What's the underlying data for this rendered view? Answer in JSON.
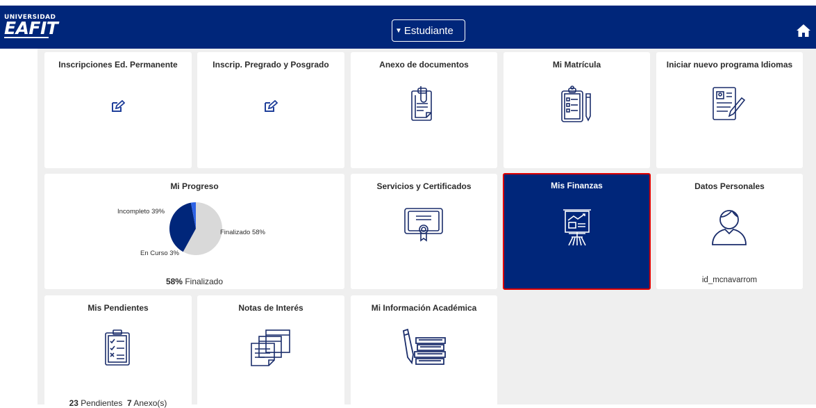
{
  "header": {
    "logo_top": "UNIVERSIDAD",
    "logo_main": "EAFIT",
    "role_selector": "Estudiante",
    "home_icon": "home-icon"
  },
  "tiles": {
    "inscripciones": {
      "title": "Inscripciones Ed. Permanente",
      "icon": "edit-icon"
    },
    "inscrip_pregrado": {
      "title": "Inscrip. Pregrado y Posgrado",
      "icon": "edit-icon"
    },
    "anexo": {
      "title": "Anexo de documentos",
      "icon": "clipboard-attachment-icon"
    },
    "matricula": {
      "title": "Mi Matrícula",
      "icon": "clipboard-checklist-icon"
    },
    "idiomas": {
      "title": "Iniciar nuevo programa Idiomas",
      "icon": "form-pen-icon"
    },
    "progreso": {
      "title": "Mi Progreso",
      "footer_value": "58%",
      "footer_label": "Finalizado"
    },
    "servicios": {
      "title": "Servicios y Certificados",
      "icon": "certificate-icon"
    },
    "finanzas": {
      "title": "Mis Finanzas",
      "icon": "presentation-board-icon"
    },
    "datos": {
      "title": "Datos Personales",
      "icon": "user-icon",
      "username": "id_mcnavarrom"
    },
    "pendientes": {
      "title": "Mis Pendientes",
      "icon": "checklist-icon",
      "count_pendientes": "23",
      "label_pendientes": "Pendientes",
      "count_anexos": "7",
      "label_anexos": "Anexo(s)"
    },
    "notas": {
      "title": "Notas de Interés",
      "icon": "notes-icon"
    },
    "info_academica": {
      "title": "Mi Información Académica",
      "icon": "books-pen-icon"
    }
  },
  "chart_data": {
    "type": "pie",
    "categories": [
      "Finalizado",
      "Incompleto",
      "En Curso"
    ],
    "values": [
      58,
      39,
      3
    ],
    "labels": [
      "Finalizado 58%",
      "Incompleto 39%",
      "En Curso 3%"
    ],
    "colors": [
      "#d9d9d9",
      "#00267a",
      "#2e63e6"
    ]
  },
  "colors": {
    "header_bg": "#00267a",
    "selected_tile_bg": "#00267a",
    "selected_border": "#e00000",
    "icon_blue": "#1f3f9a",
    "grid_bg": "#efefef"
  }
}
